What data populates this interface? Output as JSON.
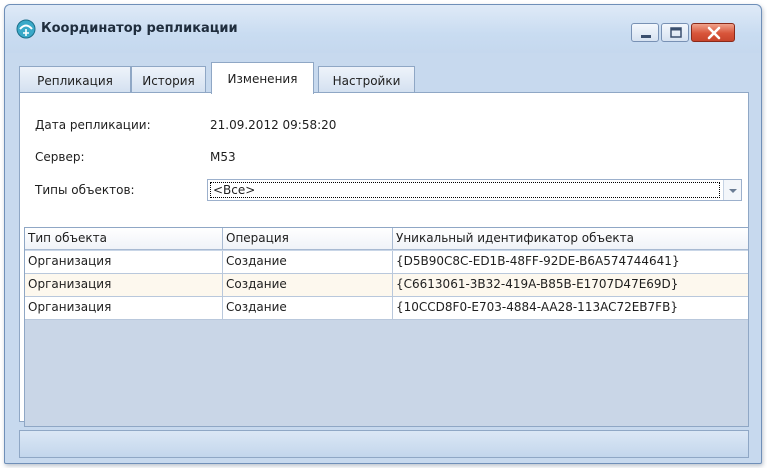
{
  "window": {
    "title": "Координатор репликации",
    "icon": "replication-icon",
    "buttons": [
      "minimize-icon",
      "maximize-icon",
      "close-icon"
    ]
  },
  "tabs": [
    {
      "label": "Репликация",
      "active": false
    },
    {
      "label": "История",
      "active": false
    },
    {
      "label": "Изменения",
      "active": true
    },
    {
      "label": "Настройки",
      "active": false
    }
  ],
  "details": {
    "date_label": "Дата репликации:",
    "date_value": "21.09.2012 09:58:20",
    "server_label": "Сервер:",
    "server_value": "M53",
    "types_label": "Типы объектов:",
    "types_value": "<Все>"
  },
  "grid": {
    "columns": [
      "Тип объекта",
      "Операция",
      "Уникальный идентификатор объекта"
    ],
    "rows": [
      [
        "Организация",
        "Создание",
        "{D5B90C8C-ED1B-48FF-92DE-B6A574744641}"
      ],
      [
        "Организация",
        "Создание",
        "{C6613061-3B32-419A-B85B-E1707D47E69D}"
      ],
      [
        "Организация",
        "Создание",
        "{10CCD8F0-E703-4884-AA28-113AC72EB7FB}"
      ]
    ]
  },
  "colors": {
    "frame": "#c7d9ee",
    "border": "#8fa7c5",
    "close_button": "#d8553a",
    "alt_row": "#fdf8ee"
  }
}
